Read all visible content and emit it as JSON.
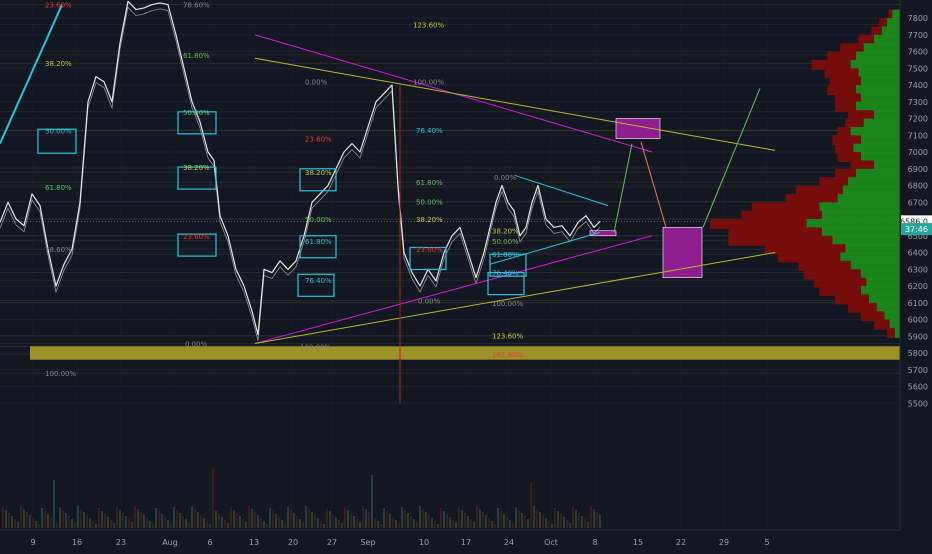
{
  "colors": {
    "background": "#131722",
    "price": "#e6e6e6",
    "axis_text": "#9aa0a6",
    "fib_cyan": "#26c6da",
    "fib_yellow": "#c8c84b",
    "fib_red": "#e53935",
    "fib_green": "#66bb6a",
    "magenta": "#d81bd8",
    "yellow_line": "#b8b832",
    "vp_up": "#1b8a1b",
    "vp_down": "#7a0d0d",
    "box_fill": "#8e1d8e",
    "support_zone": "#b5a82a"
  },
  "chart_data": {
    "type": "line",
    "title": "",
    "xlabel": "",
    "ylabel": "",
    "x_ticks": [
      "9",
      "16",
      "23",
      "Aug",
      "6",
      "13",
      "20",
      "27",
      "Sep",
      "10",
      "17",
      "24",
      "Oct",
      "8",
      "15",
      "22",
      "29",
      "5"
    ],
    "y_ticks": [
      7800,
      7700,
      7600,
      7500,
      7400,
      7300,
      7200,
      7100,
      7000,
      6900,
      6800,
      6700,
      6600,
      6500,
      6400,
      6300,
      6200,
      6100,
      6000,
      5900,
      5800,
      5700,
      5600,
      5500
    ],
    "ylim": [
      5450,
      7880
    ],
    "last_price": {
      "label": "6586.0",
      "value": 6586
    },
    "countdown": {
      "label": "37:46",
      "value": 6540
    },
    "fib_labels": [
      {
        "text": "23.60%",
        "value": 7880
      },
      {
        "text": "38.20%",
        "value": 7530
      },
      {
        "text": "50.00%",
        "value": 7127
      },
      {
        "text": "61.80%",
        "value": 6790
      },
      {
        "text": "78.60%",
        "value": 6420
      },
      {
        "text": "100.00%",
        "value": 5680
      },
      {
        "text": "78.60%",
        "value": 7880
      },
      {
        "text": "61.80%",
        "value": 7580
      },
      {
        "text": "50.00%",
        "value": 7240
      },
      {
        "text": "38.20%",
        "value": 6910
      },
      {
        "text": "23.60%",
        "value": 6500
      },
      {
        "text": "0.00%",
        "value": 5857
      },
      {
        "text": "38.20%",
        "value": 6880
      },
      {
        "text": "50.00%",
        "value": 6600
      },
      {
        "text": "61.80%",
        "value": 6470
      },
      {
        "text": "76.40%",
        "value": 6235
      },
      {
        "text": "100.00%",
        "value": 5838
      },
      {
        "text": "123.60%",
        "value": 7760
      },
      {
        "text": "0.00%",
        "value": 7420
      },
      {
        "text": "100.00%",
        "value": 7420
      },
      {
        "text": "23.60%",
        "value": 7080
      },
      {
        "text": "76.40%",
        "value": 7130
      },
      {
        "text": "61.80%",
        "value": 6820
      },
      {
        "text": "50.00%",
        "value": 6705
      },
      {
        "text": "38.20%",
        "value": 6600
      },
      {
        "text": "23.60%",
        "value": 6420
      },
      {
        "text": "0.00%",
        "value": 6112
      },
      {
        "text": "0.00%",
        "value": 6850
      },
      {
        "text": "38.20%",
        "value": 6530
      },
      {
        "text": "50.00%",
        "value": 6470
      },
      {
        "text": "61.80%",
        "value": 6390
      },
      {
        "text": "76.40%",
        "value": 6280
      },
      {
        "text": "100.00%",
        "value": 6100
      },
      {
        "text": "123.60%",
        "value": 5905
      },
      {
        "text": "161.80%",
        "value": 5790
      }
    ],
    "price_path": [
      [
        0,
        6580
      ],
      [
        8,
        6700
      ],
      [
        16,
        6600
      ],
      [
        24,
        6560
      ],
      [
        32,
        6750
      ],
      [
        40,
        6680
      ],
      [
        48,
        6420
      ],
      [
        56,
        6200
      ],
      [
        64,
        6330
      ],
      [
        72,
        6420
      ],
      [
        80,
        6700
      ],
      [
        88,
        7300
      ],
      [
        96,
        7450
      ],
      [
        104,
        7420
      ],
      [
        112,
        7300
      ],
      [
        120,
        7650
      ],
      [
        128,
        7900
      ],
      [
        136,
        7850
      ],
      [
        144,
        7860
      ],
      [
        152,
        7880
      ],
      [
        160,
        7890
      ],
      [
        168,
        7880
      ],
      [
        176,
        7700
      ],
      [
        184,
        7500
      ],
      [
        192,
        7300
      ],
      [
        200,
        7180
      ],
      [
        208,
        7000
      ],
      [
        214,
        6950
      ],
      [
        220,
        6620
      ],
      [
        228,
        6500
      ],
      [
        236,
        6300
      ],
      [
        244,
        6200
      ],
      [
        252,
        6050
      ],
      [
        258,
        5910
      ],
      [
        264,
        6300
      ],
      [
        272,
        6280
      ],
      [
        280,
        6350
      ],
      [
        288,
        6300
      ],
      [
        296,
        6350
      ],
      [
        304,
        6500
      ],
      [
        312,
        6700
      ],
      [
        320,
        6750
      ],
      [
        328,
        6800
      ],
      [
        336,
        6900
      ],
      [
        344,
        7000
      ],
      [
        352,
        7050
      ],
      [
        360,
        7000
      ],
      [
        368,
        7150
      ],
      [
        376,
        7300
      ],
      [
        384,
        7350
      ],
      [
        392,
        7400
      ],
      [
        398,
        6800
      ],
      [
        404,
        6400
      ],
      [
        412,
        6280
      ],
      [
        420,
        6200
      ],
      [
        428,
        6300
      ],
      [
        436,
        6230
      ],
      [
        444,
        6400
      ],
      [
        452,
        6500
      ],
      [
        460,
        6550
      ],
      [
        468,
        6400
      ],
      [
        476,
        6250
      ],
      [
        484,
        6400
      ],
      [
        490,
        6550
      ],
      [
        496,
        6700
      ],
      [
        502,
        6800
      ],
      [
        508,
        6700
      ],
      [
        514,
        6650
      ],
      [
        520,
        6500
      ],
      [
        526,
        6550
      ],
      [
        532,
        6700
      ],
      [
        538,
        6800
      ],
      [
        546,
        6600
      ],
      [
        554,
        6550
      ],
      [
        562,
        6560
      ],
      [
        570,
        6500
      ],
      [
        578,
        6580
      ],
      [
        586,
        6620
      ],
      [
        594,
        6550
      ],
      [
        600,
        6586
      ]
    ],
    "volume_profile": [
      {
        "price": 7820,
        "up": 6,
        "down": 3
      },
      {
        "price": 7770,
        "up": 10,
        "down": 6
      },
      {
        "price": 7720,
        "up": 14,
        "down": 8
      },
      {
        "price": 7670,
        "up": 20,
        "down": 12
      },
      {
        "price": 7620,
        "up": 28,
        "down": 18
      },
      {
        "price": 7570,
        "up": 34,
        "down": 22
      },
      {
        "price": 7520,
        "up": 38,
        "down": 30
      },
      {
        "price": 7470,
        "up": 32,
        "down": 26
      },
      {
        "price": 7420,
        "up": 30,
        "down": 24
      },
      {
        "price": 7370,
        "up": 34,
        "down": 22
      },
      {
        "price": 7320,
        "up": 30,
        "down": 20
      },
      {
        "price": 7270,
        "up": 34,
        "down": 16
      },
      {
        "price": 7220,
        "up": 20,
        "down": 20
      },
      {
        "price": 7170,
        "up": 28,
        "down": 14
      },
      {
        "price": 7120,
        "up": 38,
        "down": 10
      },
      {
        "price": 7070,
        "up": 30,
        "down": 22
      },
      {
        "price": 7020,
        "up": 36,
        "down": 14
      },
      {
        "price": 6970,
        "up": 30,
        "down": 18
      },
      {
        "price": 6920,
        "up": 20,
        "down": 18
      },
      {
        "price": 6870,
        "up": 34,
        "down": 16
      },
      {
        "price": 6820,
        "up": 40,
        "down": 22
      },
      {
        "price": 6770,
        "up": 44,
        "down": 36
      },
      {
        "price": 6720,
        "up": 48,
        "down": 40
      },
      {
        "price": 6670,
        "up": 62,
        "down": 52
      },
      {
        "price": 6620,
        "up": 60,
        "down": 62
      },
      {
        "price": 6570,
        "up": 72,
        "down": 74
      },
      {
        "price": 6520,
        "up": 60,
        "down": 72
      },
      {
        "price": 6470,
        "up": 52,
        "down": 80
      },
      {
        "price": 6420,
        "up": 42,
        "down": 62
      },
      {
        "price": 6370,
        "up": 46,
        "down": 48
      },
      {
        "price": 6320,
        "up": 38,
        "down": 40
      },
      {
        "price": 6270,
        "up": 30,
        "down": 44
      },
      {
        "price": 6220,
        "up": 26,
        "down": 40
      },
      {
        "price": 6170,
        "up": 30,
        "down": 32
      },
      {
        "price": 6120,
        "up": 24,
        "down": 26
      },
      {
        "price": 6070,
        "up": 18,
        "down": 22
      },
      {
        "price": 6020,
        "up": 12,
        "down": 18
      },
      {
        "price": 5970,
        "up": 8,
        "down": 12
      },
      {
        "price": 5920,
        "up": 4,
        "down": 6
      }
    ],
    "fib_levels": [
      7880,
      7530,
      7127,
      6790,
      6420,
      5680,
      7760,
      7580,
      7240,
      7130,
      6910,
      6880,
      6820,
      6705,
      6600,
      6500,
      6470,
      6390,
      6280,
      6235,
      6112,
      6100,
      5905,
      5857,
      5838,
      5790
    ]
  },
  "drawing_values": {
    "support_zone": {
      "from": 5760,
      "to": 5840
    },
    "target_box_upper": {
      "from": 7080,
      "to": 7200
    },
    "target_box_lower": {
      "from": 6250,
      "to": 6550
    },
    "small_box": {
      "from": 6500,
      "to": 6530
    }
  }
}
